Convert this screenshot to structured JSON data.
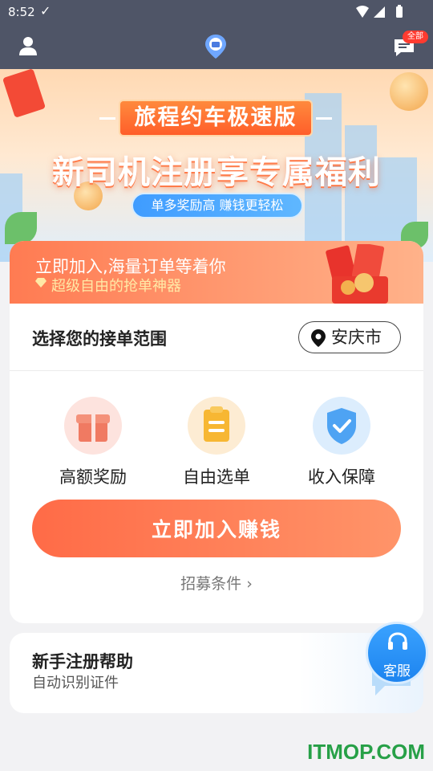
{
  "status_bar": {
    "time": "8:52",
    "check": "✓"
  },
  "app_bar": {
    "badge": "全部"
  },
  "banner": {
    "heading": "旅程约车极速版",
    "title": "新司机注册享专属福利",
    "pill": "单多奖励高 赚钱更轻松"
  },
  "promo": {
    "line1": "立即加入,海量订单等着你",
    "line2": "超级自由的抢单神器"
  },
  "range": {
    "label": "选择您的接单范围",
    "city": "安庆市"
  },
  "features": [
    {
      "label": "高额奖励"
    },
    {
      "label": "自由选单"
    },
    {
      "label": "收入保障"
    }
  ],
  "join_button": "立即加入赚钱",
  "conditions_link": "招募条件 ›",
  "help": {
    "title": "新手注册帮助",
    "subtitle": "自动识别证件"
  },
  "service_label": "客服",
  "watermark": "ITMOP.COM",
  "colors": {
    "accent": "#ff6b47",
    "service": "#1d84ef",
    "appbar": "#4f5567"
  }
}
